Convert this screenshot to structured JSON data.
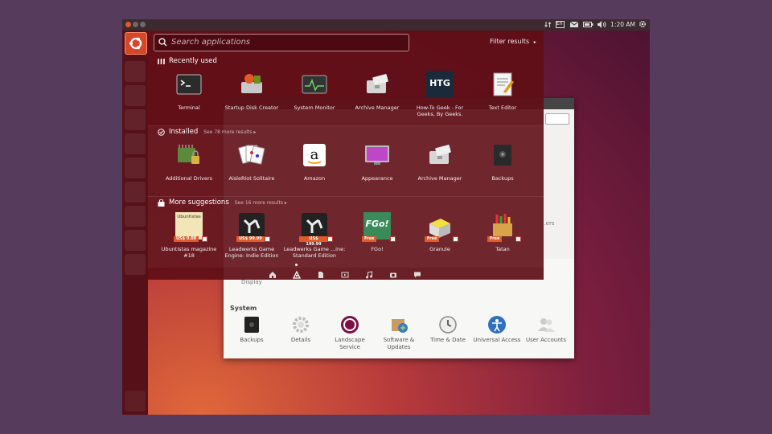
{
  "topbar": {
    "keyboard_indicator": "En",
    "clock": "1:20 AM"
  },
  "dash": {
    "search_placeholder": "Search applications",
    "filter_label": "Filter results",
    "recent": {
      "title": "Recently used",
      "apps": [
        {
          "label": "Terminal"
        },
        {
          "label": "Startup Disk Creator"
        },
        {
          "label": "System Monitor"
        },
        {
          "label": "Archive Manager"
        },
        {
          "label": "How-To Geek - For Geeks, By Geeks.",
          "icon_text": "HTG"
        },
        {
          "label": "Text Editor"
        }
      ]
    },
    "installed": {
      "title": "Installed",
      "more": "See 78 more results",
      "apps": [
        {
          "label": "Additional Drivers"
        },
        {
          "label": "AisleRiot Solitaire"
        },
        {
          "label": "Amazon"
        },
        {
          "label": "Appearance"
        },
        {
          "label": "Archive Manager"
        },
        {
          "label": "Backups"
        }
      ]
    },
    "suggestions": {
      "title": "More suggestions",
      "more": "See 16 more results",
      "apps": [
        {
          "label": "Ubuntistas magazine #18",
          "price": "US$ 0.00",
          "icon_text": "Ubuntistas"
        },
        {
          "label": "Leadwerks Game Engine: Indie Edition",
          "price": "US$ 99.99"
        },
        {
          "label": "Leadwerks Game ...ine: Standard Edition",
          "price": "US$ 199.99"
        },
        {
          "label": "FGo!",
          "price": "Free",
          "icon_text": "FGo!"
        },
        {
          "label": "Granule",
          "price": "Free"
        },
        {
          "label": "Tatan",
          "price": "Free"
        }
      ]
    }
  },
  "settings": {
    "display_label": "Display",
    "printers_label": "...ers",
    "system_title": "System",
    "system_items": [
      {
        "label": "Backups"
      },
      {
        "label": "Details"
      },
      {
        "label": "Landscape Service"
      },
      {
        "label": "Software & Updates"
      },
      {
        "label": "Time & Date"
      },
      {
        "label": "Universal Access"
      },
      {
        "label": "User Accounts"
      }
    ]
  },
  "colors": {
    "accent": "#e05a2a",
    "dash_bg": "#600e16",
    "launcher": "#561017"
  }
}
